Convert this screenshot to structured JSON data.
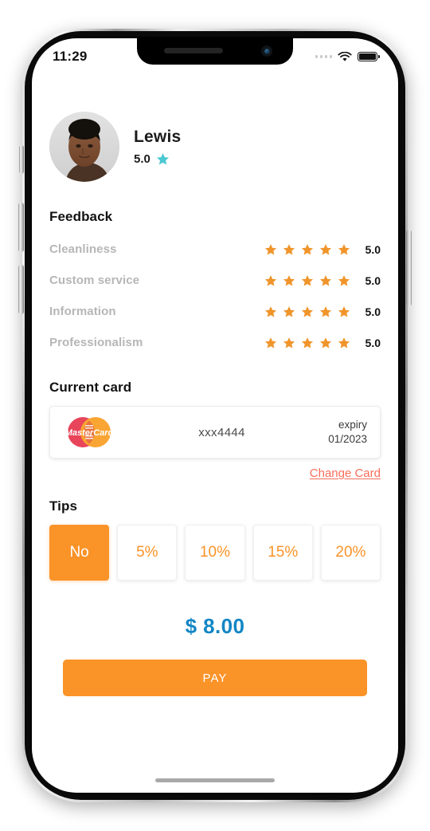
{
  "statusbar": {
    "time": "11:29",
    "signal_icon": "signal-dots-icon",
    "wifi_icon": "wifi-icon",
    "battery_icon": "battery-full-icon"
  },
  "profile": {
    "name": "Lewis",
    "rating": "5.0",
    "rating_star_icon": "star-icon",
    "avatar_alt": "user-avatar"
  },
  "feedback": {
    "title": "Feedback",
    "rows": [
      {
        "label": "Cleanliness",
        "stars": 5,
        "score": "5.0"
      },
      {
        "label": "Custom service",
        "stars": 5,
        "score": "5.0"
      },
      {
        "label": "Information",
        "stars": 5,
        "score": "5.0"
      },
      {
        "label": "Professionalism",
        "stars": 5,
        "score": "5.0"
      }
    ]
  },
  "card": {
    "title": "Current card",
    "brand": "MasterCard",
    "brand_logo_icon": "mastercard-logo-icon",
    "number": "xxx4444",
    "expiry_label": "expiry",
    "expiry_value": "01/2023",
    "change_link": "Change Card"
  },
  "tips": {
    "title": "Tips",
    "options": [
      {
        "label": "No",
        "selected": true
      },
      {
        "label": "5%",
        "selected": false
      },
      {
        "label": "10%",
        "selected": false
      },
      {
        "label": "15%",
        "selected": false
      },
      {
        "label": "20%",
        "selected": false
      }
    ]
  },
  "total": {
    "amount": "$ 8.00"
  },
  "actions": {
    "pay_label": "PAY"
  },
  "colors": {
    "accent_orange": "#fa9328",
    "star_orange": "#f0952b",
    "star_teal": "#4bc8d2",
    "amount_blue": "#1286c4",
    "link_red": "#fa6d5b",
    "label_gray": "#b6b6b6"
  }
}
